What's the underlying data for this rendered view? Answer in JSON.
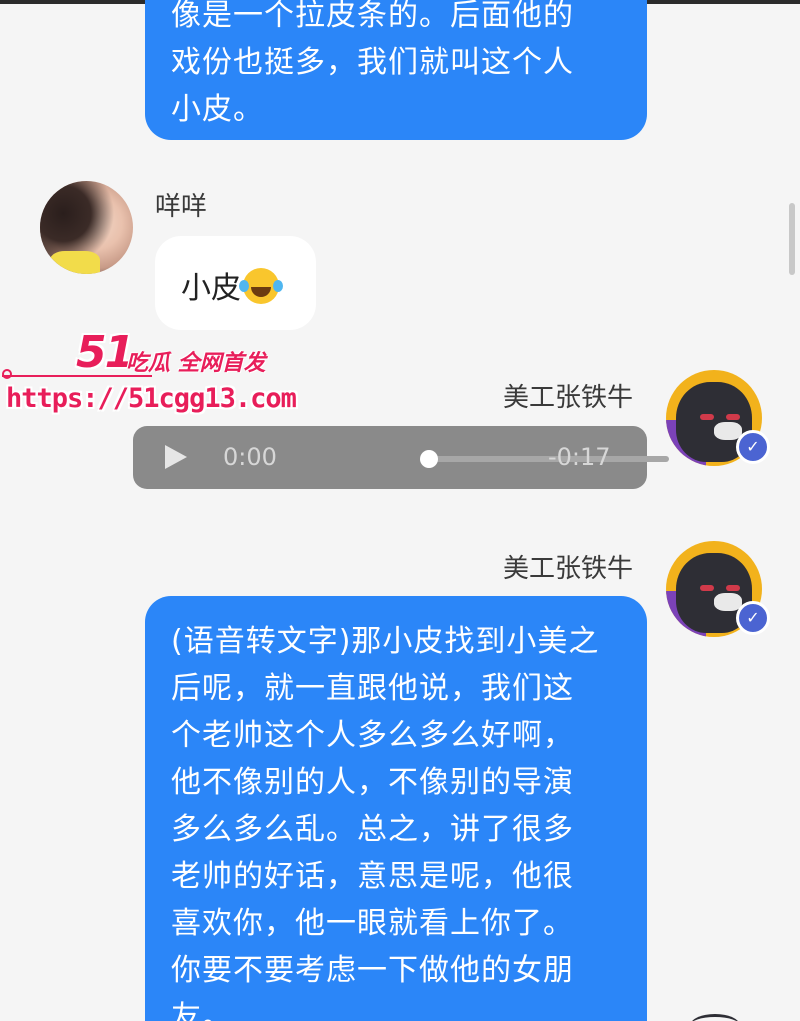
{
  "messages": {
    "m1": {
      "lines": [
        "像是一个拉皮条的。后面他的",
        "戏份也挺多，我们就叫这个人",
        "小皮。"
      ]
    },
    "m2": {
      "sender": "咩咩",
      "text": "小皮",
      "emoji": "laughing-with-tears"
    },
    "m3": {
      "sender": "美工张铁牛",
      "audio": {
        "current_time": "0:00",
        "remaining_time": "-0:17",
        "progress": 0
      }
    },
    "m4": {
      "sender": "美工张铁牛",
      "lines": [
        "(语音转文字)那小皮找到小美之",
        "后呢，就一直跟他说，我们这",
        "个老帅这个人多么多么好啊，",
        "他不像别的人，不像别的导演",
        "多么多么乱。总之，讲了很多",
        "老帅的好话，意思是呢，他很",
        "喜欢你，他一眼就看上你了。",
        "你要不要考虑一下做他的女朋",
        "友。"
      ]
    }
  },
  "watermark": {
    "logo": "51",
    "slogan": "吃瓜 全网首发",
    "url": "https://51cgg13.com"
  },
  "colors": {
    "bubble_blue": "#2b86f8",
    "bubble_white": "#ffffff",
    "background": "#f5f5f5",
    "watermark": "#e81e5a"
  }
}
